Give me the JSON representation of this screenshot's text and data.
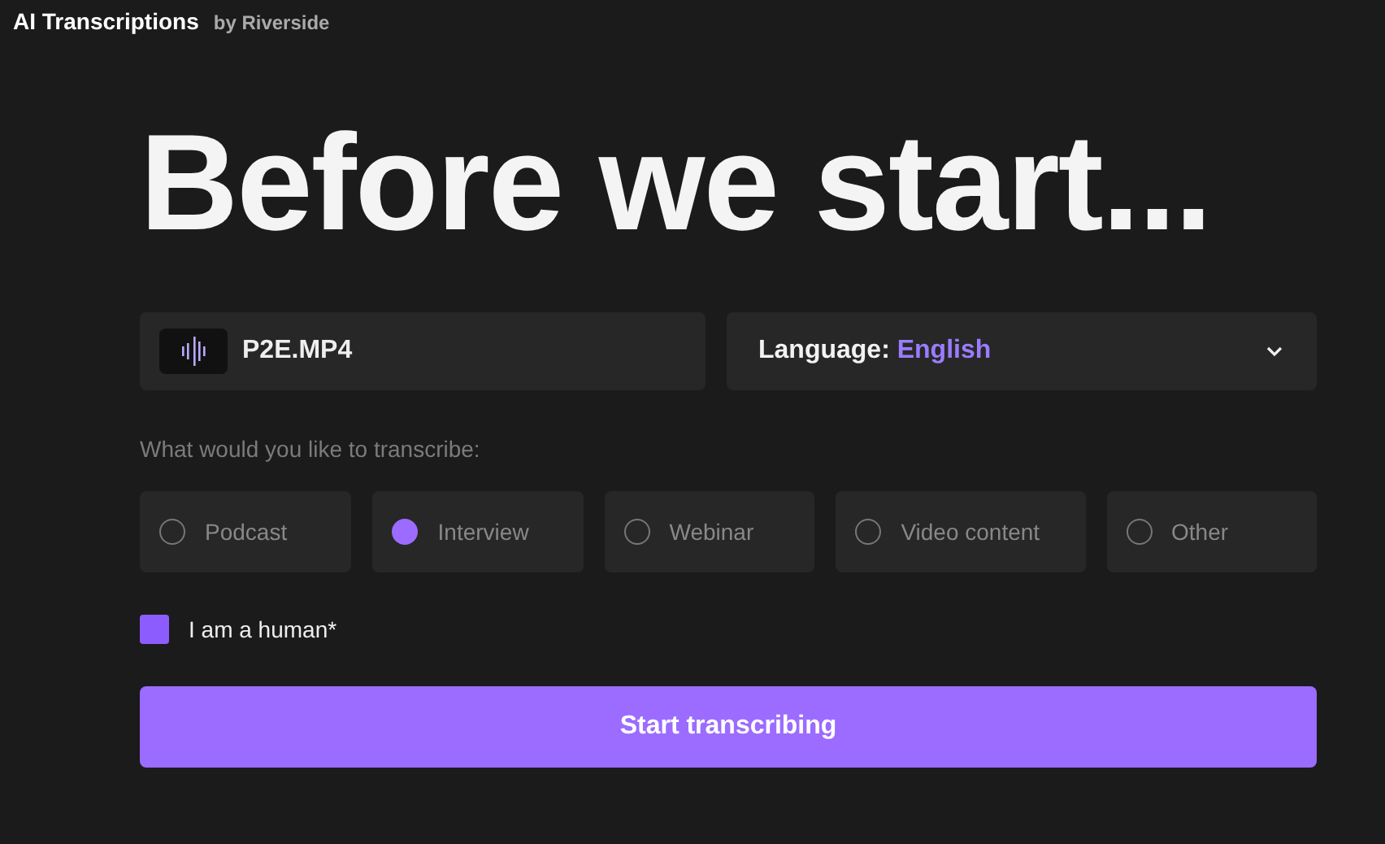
{
  "header": {
    "title": "AI Transcriptions",
    "byline": "by Riverside"
  },
  "heading": "Before we start...",
  "file": {
    "name": "P2E.MP4"
  },
  "language": {
    "label": "Language:",
    "value": "English"
  },
  "question": "What would you like to transcribe:",
  "options": [
    {
      "label": "Podcast",
      "selected": false
    },
    {
      "label": "Interview",
      "selected": true
    },
    {
      "label": "Webinar",
      "selected": false
    },
    {
      "label": "Video content",
      "selected": false
    },
    {
      "label": "Other",
      "selected": false
    }
  ],
  "consent": {
    "label": "I am a human*",
    "checked": true
  },
  "submit": "Start transcribing"
}
